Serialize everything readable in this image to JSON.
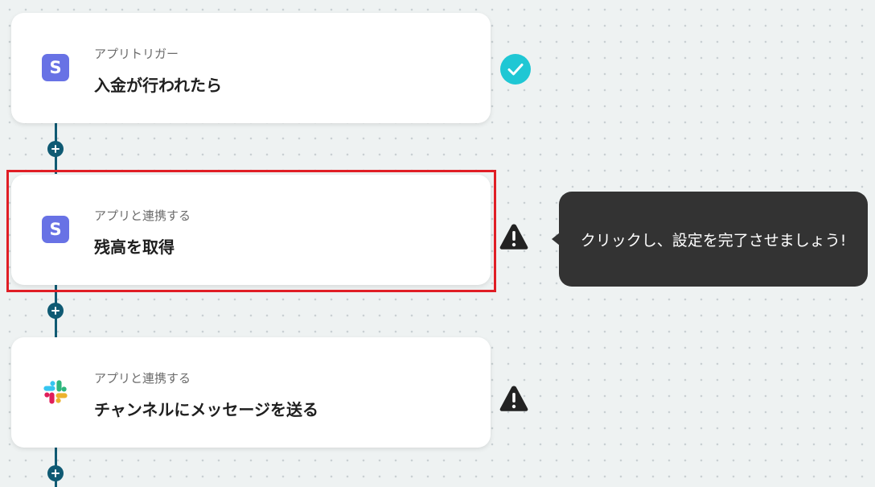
{
  "steps": [
    {
      "subtitle": "アプリトリガー",
      "title": "入金が行われたら",
      "app_icon": "stripe-icon",
      "status": "complete"
    },
    {
      "subtitle": "アプリと連携する",
      "title": "残高を取得",
      "app_icon": "stripe-icon",
      "status": "warning"
    },
    {
      "subtitle": "アプリと連携する",
      "title": "チャンネルにメッセージを送る",
      "app_icon": "slack-icon",
      "status": "warning"
    }
  ],
  "stripe_letter": "S",
  "tooltip": {
    "text": "クリックし、設定を完了させましょう!"
  },
  "colors": {
    "connector": "#0f5a73",
    "check": "#1fc7d4",
    "warning": "#222222",
    "highlight": "#e01e25",
    "stripe": "#6872e5",
    "tooltip_bg": "#333333"
  }
}
